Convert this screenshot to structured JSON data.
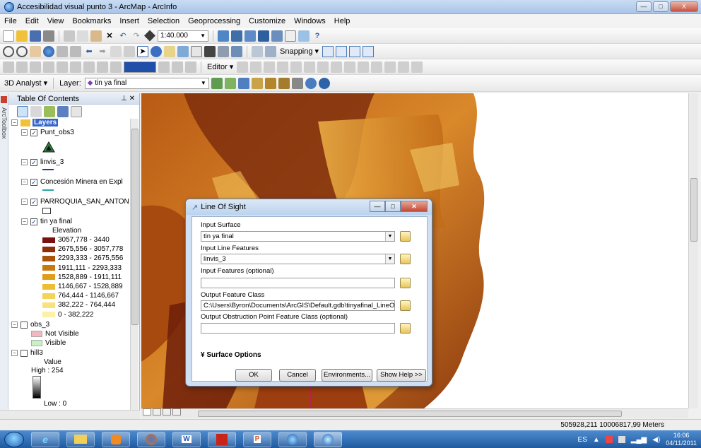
{
  "window": {
    "title": "Accesibilidad visual punto 3 - ArcMap - ArcInfo",
    "min_label": "—",
    "max_label": "□",
    "close_label": "X"
  },
  "menu": [
    "File",
    "Edit",
    "View",
    "Bookmarks",
    "Insert",
    "Selection",
    "Geoprocessing",
    "Customize",
    "Windows",
    "Help"
  ],
  "toolbar": {
    "scale": "1:40.000",
    "snapping": "Snapping ▾",
    "editor": "Editor ▾",
    "analyst_3d": "3D Analyst ▾",
    "layer_label": "Layer:",
    "layer_value": "tin ya final"
  },
  "toc": {
    "title": "Table Of Contents",
    "side_tab": "ArcToolbox",
    "layers_label": "Layers",
    "items": {
      "punt_obs3": "Punt_obs3",
      "linvis_3": "linvis_3",
      "concesion": "Concesión Minera en Expl",
      "parroquia": "PARROQUIA_SAN_ANTON",
      "tin": "tin ya final",
      "elevation": "Elevation",
      "obs_3": "obs_3",
      "not_visible": "Not Visible",
      "visible": "Visible",
      "hill3": "hill3",
      "value": "Value",
      "high": "High : 254",
      "low": "Low : 0"
    },
    "elevation_classes": [
      {
        "label": "3057,778 - 3440",
        "color": "#7a1010"
      },
      {
        "label": "2675,556 - 3057,778",
        "color": "#8c2f0b"
      },
      {
        "label": "2293,333 - 2675,556",
        "color": "#a9530b"
      },
      {
        "label": "1911,111 - 2293,333",
        "color": "#c8780f"
      },
      {
        "label": "1528,889 - 1911,111",
        "color": "#e09d1a"
      },
      {
        "label": "1146,667 - 1528,889",
        "color": "#efbd33"
      },
      {
        "label": "764,444 - 1146,667",
        "color": "#f4d35a"
      },
      {
        "label": "382,222 - 764,444",
        "color": "#f7e27f"
      },
      {
        "label": "0 - 382,222",
        "color": "#fbf1a8"
      }
    ]
  },
  "dialog": {
    "title": "Line Of Sight",
    "input_surface_label": "Input Surface",
    "input_surface_value": "tin ya final",
    "input_line_label": "Input Line Features",
    "input_line_value": "linvis_3",
    "input_features_label": "Input Features (optional)",
    "input_features_value": "",
    "output_fc_label": "Output Feature Class",
    "output_fc_value": "C:\\Users\\Byron\\Documents\\ArcGIS\\Default.gdb\\tinyafinal_LineOfSight",
    "output_obstruction_label": "Output Obstruction Point Feature Class (optional)",
    "output_obstruction_value": "",
    "surface_options": "Surface Options",
    "ok": "OK",
    "cancel": "Cancel",
    "environments": "Environments...",
    "show_help": "Show Help >>"
  },
  "status": {
    "coordinates": "505928,211  10006817,99 Meters"
  },
  "taskbar": {
    "lang": "ES",
    "time": "16:06",
    "date": "04/11/2011"
  },
  "colors": {
    "map_dark": "#7a2a0c",
    "map_mid": "#c46a14",
    "map_light": "#e9a63a",
    "selection": "#3465c9"
  }
}
